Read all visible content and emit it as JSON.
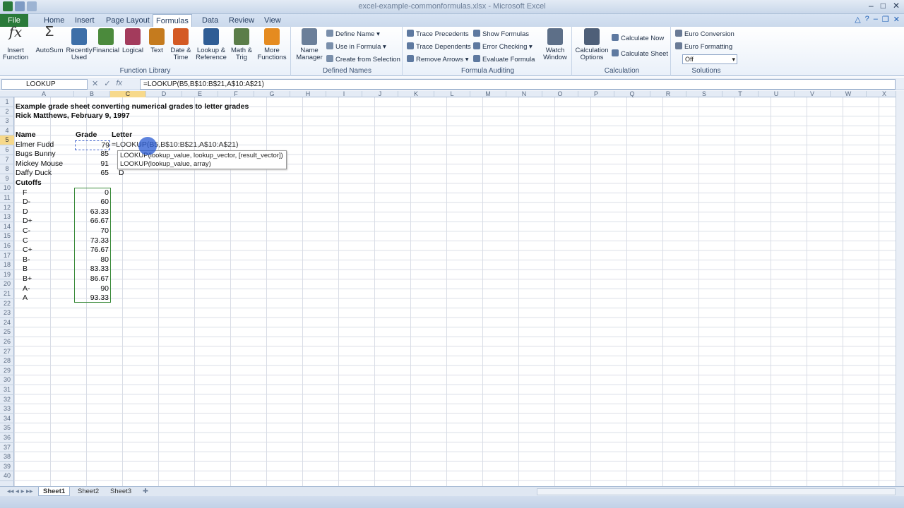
{
  "window": {
    "title": "excel-example-commonformulas.xlsx - Microsoft Excel"
  },
  "tabs": [
    "File",
    "Home",
    "Insert",
    "Page Layout",
    "Formulas",
    "Data",
    "Review",
    "View"
  ],
  "active_tab": "Formulas",
  "ribbon": {
    "function_library": {
      "label": "Function Library",
      "buttons": [
        "Insert Function",
        "AutoSum",
        "Recently Used",
        "Financial",
        "Logical",
        "Text",
        "Date & Time",
        "Lookup & Reference",
        "Math & Trig",
        "More Functions"
      ]
    },
    "defined_names": {
      "label": "Defined Names",
      "name_manager": "Name Manager",
      "define_name": "Define Name",
      "use_in_formula": "Use in Formula",
      "create_from_selection": "Create from Selection"
    },
    "formula_auditing": {
      "label": "Formula Auditing",
      "trace_precedents": "Trace Precedents",
      "trace_dependents": "Trace Dependents",
      "remove_arrows": "Remove Arrows",
      "show_formulas": "Show Formulas",
      "error_checking": "Error Checking",
      "evaluate_formula": "Evaluate Formula",
      "watch_window": "Watch Window"
    },
    "calculation": {
      "label": "Calculation",
      "options": "Calculation Options",
      "calc_now": "Calculate Now",
      "calc_sheet": "Calculate Sheet"
    },
    "solutions": {
      "label": "Solutions",
      "euro_conversion": "Euro Conversion",
      "euro_formatting": "Euro Formatting",
      "dropdown_value": "Off"
    }
  },
  "formula_bar": {
    "name_box": "LOOKUP",
    "formula": "=LOOKUP(B5,B$10:B$21,A$10:A$21)"
  },
  "columns": [
    "A",
    "B",
    "C",
    "D",
    "E",
    "F",
    "G",
    "H",
    "I",
    "J",
    "K",
    "L",
    "M",
    "N",
    "O",
    "P",
    "Q",
    "R",
    "S",
    "T",
    "U",
    "V",
    "W",
    "X"
  ],
  "rows": [
    "1",
    "2",
    "3",
    "4",
    "5",
    "6",
    "7",
    "8",
    "9",
    "10",
    "11",
    "12",
    "13",
    "14",
    "15",
    "16",
    "17",
    "18",
    "19",
    "20",
    "21",
    "22",
    "23",
    "24",
    "25",
    "26",
    "27",
    "28",
    "29",
    "30",
    "31",
    "32",
    "33",
    "34",
    "35",
    "36",
    "37",
    "38",
    "39",
    "40"
  ],
  "sheet": {
    "title": "Example grade sheet converting numerical grades to letter grades",
    "subtitle": "Rick Matthews, February 9, 1997",
    "header_name": "Name",
    "header_grade": "Grade",
    "header_letter": "Letter",
    "students": [
      {
        "name": "Elmer Fudd",
        "grade": "79",
        "letter": "=LOOKUP(B5,B$10:B$21,A$10:A$21)"
      },
      {
        "name": "Bugs Bunny",
        "grade": "85",
        "letter": ""
      },
      {
        "name": "Mickey Mouse",
        "grade": "91",
        "letter": ""
      },
      {
        "name": "Daffy Duck",
        "grade": "65",
        "letter": "D"
      }
    ],
    "cutoffs_label": "Cutoffs",
    "cutoffs": [
      {
        "letter": "F",
        "value": "0"
      },
      {
        "letter": "D-",
        "value": "60"
      },
      {
        "letter": "D",
        "value": "63.33"
      },
      {
        "letter": "D+",
        "value": "66.67"
      },
      {
        "letter": "C-",
        "value": "70"
      },
      {
        "letter": "C",
        "value": "73.33"
      },
      {
        "letter": "C+",
        "value": "76.67"
      },
      {
        "letter": "B-",
        "value": "80"
      },
      {
        "letter": "B",
        "value": "83.33"
      },
      {
        "letter": "B+",
        "value": "86.67"
      },
      {
        "letter": "A-",
        "value": "90"
      },
      {
        "letter": "A",
        "value": "93.33"
      }
    ]
  },
  "tooltip": {
    "line1": "LOOKUP(lookup_value, lookup_vector, [result_vector])",
    "line2": "LOOKUP(lookup_value, array)"
  },
  "sheet_tabs": [
    "Sheet1",
    "Sheet2",
    "Sheet3"
  ],
  "active_sheet": "Sheet1"
}
